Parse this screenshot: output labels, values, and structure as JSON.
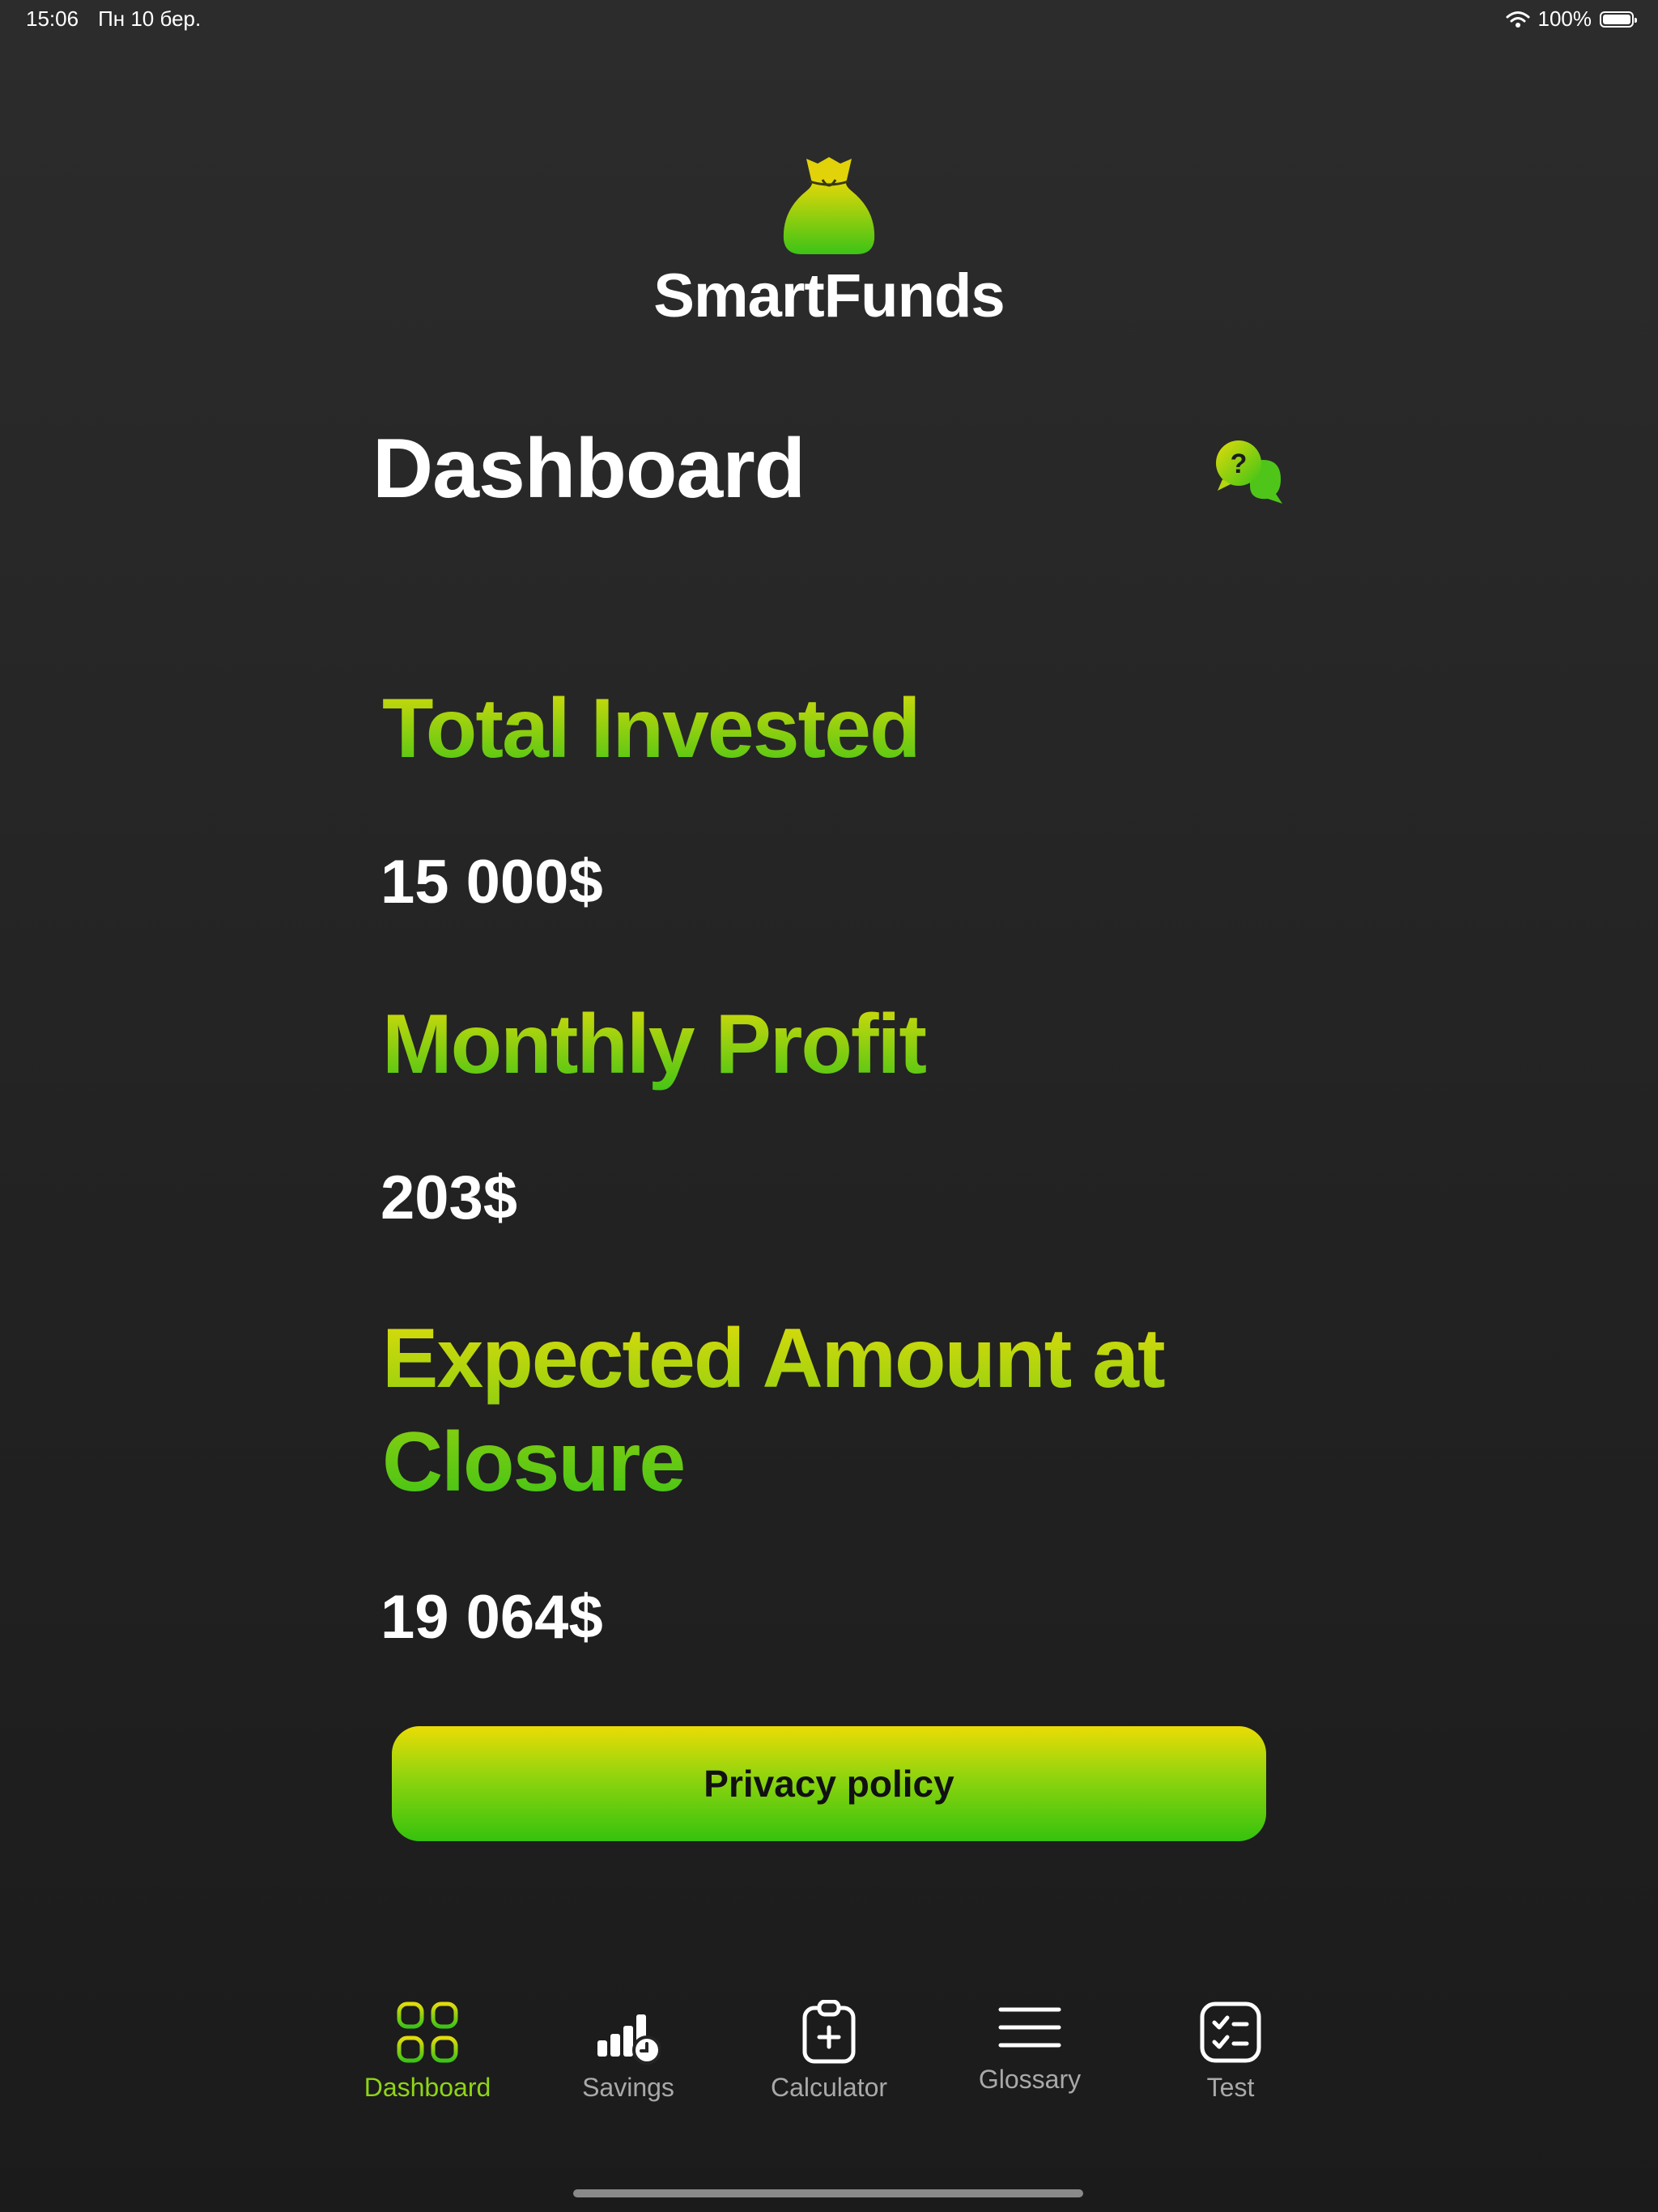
{
  "status_bar": {
    "time": "15:06",
    "date": "Пн 10 бер.",
    "battery_text": "100%",
    "battery_level": 1.0
  },
  "app": {
    "name": "SmartFunds",
    "logo_icon": "money-bag-icon"
  },
  "header": {
    "title": "Dashboard",
    "help_icon": "help-chat-icon"
  },
  "stats": [
    {
      "label": "Total Invested",
      "value": "15 000$"
    },
    {
      "label": "Monthly Profit",
      "value": "203$"
    },
    {
      "label": "Expected Amount at Closure",
      "value": "19 064$"
    }
  ],
  "privacy_button": {
    "label": "Privacy policy"
  },
  "tabs": [
    {
      "label": "Dashboard",
      "icon": "grid-icon",
      "active": true
    },
    {
      "label": "Savings",
      "icon": "bar-chart-clock-icon",
      "active": false
    },
    {
      "label": "Calculator",
      "icon": "clipboard-plus-icon",
      "active": false
    },
    {
      "label": "Glossary",
      "icon": "menu-lines-icon",
      "active": false
    },
    {
      "label": "Test",
      "icon": "checklist-icon",
      "active": false
    }
  ],
  "colors": {
    "accent_yellow": "#e3dc0a",
    "accent_green": "#3cc316",
    "active_tab": "#8ed516",
    "inactive_tab": "#a9a9a9",
    "background": "#242424"
  }
}
